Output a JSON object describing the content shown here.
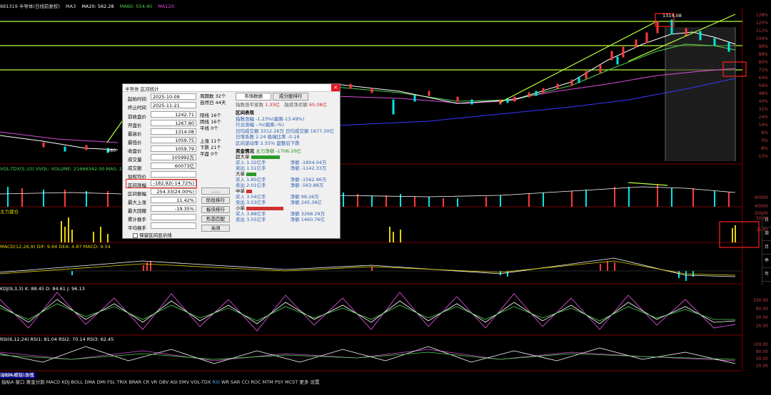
{
  "header": {
    "title": "881319 半导体(日线前复权)",
    "ma3": "MA3",
    "ma20": "MA20: 562.28",
    "ma60": "MA60: 554.40",
    "ma120": "MA120:"
  },
  "price_axis": [
    "128%",
    "120%",
    "112%",
    "104%",
    "96%",
    "88%",
    "80%",
    "72%",
    "64%",
    "56%",
    "48%",
    "40%",
    "32%",
    "24%",
    "16%",
    "8%",
    "0%",
    "-8%",
    "-15%"
  ],
  "chart_labels": {
    "high": "1314.08",
    "low_left": "480"
  },
  "vol": {
    "label": "VOL-TDX(5,10) VVOL: VOLUME: 21666342.00  MA5: 2",
    "axis": [
      "60000",
      "40000",
      "20000"
    ]
  },
  "main_force": {
    "label": "主力建仓",
    "axis": [
      "30.00",
      "15.00"
    ]
  },
  "macd": {
    "label": "MACD(12,26,9) DIF: 9.64  DEA: 4.87  MACD: 9.54"
  },
  "kdj": {
    "label": "KDJ(9,3,3) K: 88.45  D: 84.61  J: 96.13",
    "axis": [
      "100.00",
      "80.00",
      "50.00",
      "20.00"
    ]
  },
  "rsi": {
    "label": "RSI(6,12,24) RSI1: 81.04  RSI2: 70.14  RSI3: 62.45",
    "axis": [
      "100.00",
      "80.00",
      "50.00",
      "20.00"
    ]
  },
  "right_sidebar": [
    "日",
    "周",
    "月",
    "季",
    "年"
  ],
  "date_marker": "2024/07/19/五",
  "indicator_tabs": [
    "指标A",
    "窗口",
    "黄金分割",
    "MACD",
    "KDJ",
    "BOLL",
    "DMA",
    "DMI",
    "FSL",
    "TRIX",
    "BRAR",
    "CR",
    "VR",
    "OBV",
    "ASI",
    "EMV",
    "VOL-TDX",
    "RSI",
    "WR",
    "SAR",
    "CCI",
    "ROC",
    "MTM",
    "PSY",
    "MCST",
    "更多",
    "设置"
  ],
  "bottom_right": [
    "指标B",
    "模板",
    "日线"
  ],
  "dialog": {
    "title": "半导体 区间统计",
    "start_label": "起始时间",
    "start_value": "2025-10-09",
    "end_label": "终止时间",
    "end_value": "2025-11-21",
    "stats": [
      {
        "label": "前收盘价",
        "value": "1242.71"
      },
      {
        "label": "开盘价",
        "value": "1267.80"
      },
      {
        "label": "最高价",
        "value": "1314.08"
      },
      {
        "label": "最低价",
        "value": "1059.75"
      },
      {
        "label": "收盘价",
        "value": "1059.79"
      },
      {
        "label": "成交量",
        "value": "105992万"
      },
      {
        "label": "成交额",
        "value": "60073亿"
      },
      {
        "label": "加权均价",
        "value": ""
      },
      {
        "label": "区间涨幅",
        "value": "-182.92(-14.72%)"
      },
      {
        "label": "区间振幅",
        "value": "254.33(24.00%)"
      },
      {
        "label": "最大上涨",
        "value": "11.42%"
      },
      {
        "label": "最大回撤",
        "value": "-19.35%"
      },
      {
        "label": "累计换手",
        "value": ""
      },
      {
        "label": "平均换手",
        "value": ""
      }
    ],
    "period": "周期数 32个",
    "natural_days": "自然日 44天",
    "yang": "阳线 16个",
    "yin": "阴线 16个",
    "flat": "平线 0个",
    "up": "上涨 11个",
    "down": "下跌 21个",
    "flat2": "平盘 0个",
    "btn_dots": "......",
    "btn_rank": "阶段排行",
    "btn_sector": "板块排行",
    "btn_pattern": "形态匹配",
    "btn_close": "关闭",
    "keep_label": "保留区间显示线",
    "tab_market": "市场数据",
    "tab_rank": "成分股排行",
    "inflow_label": "指数涨平家数",
    "inflow_value": "1.33亿",
    "inflow2_label": "融资净买额",
    "inflow2_value": "65.08亿",
    "section_perf": "区间表现",
    "perf_rows": [
      "指数涨幅 -1.23%(偏离-13.49%)",
      "行业涨幅 --%(偏离--%)",
      "日均成交额 3312.26万    日均成交额 1877.30亿",
      "日增系数 2.24          极端比率 -0.18",
      "区间波动率 2.55%      盘整后下跌"
    ],
    "funds_title": "资金情况",
    "funds_net": "主力净额 -1706.20亿",
    "groups": [
      {
        "name": "超大单",
        "color": "#2a9a2a",
        "buy": "买入 1.32亿手",
        "sell": "卖出 1.51亿手",
        "net": "净额 -1804.04万"
      },
      {
        "name": "大单",
        "color": "#2a9a2a",
        "buy": "买入 1.85亿手",
        "sell": "卖出 2.01亿手",
        "net": "净额 -1562.96万"
      },
      {
        "name": "中单",
        "color": "#d03030",
        "buy": "买入 3.54亿手",
        "sell": "卖出 3.53亿手",
        "net": "净额 98.26万"
      },
      {
        "name": "小单",
        "color": "#d03030",
        "buy": "买入 3.88亿手",
        "sell": "卖出 3.55亿手",
        "net": "净额 3268.29万"
      }
    ],
    "extra_net": [
      "净额 -1142.33万",
      "净额 -563.88万",
      "净额 245.39亿",
      "净额 1460.76亿"
    ]
  }
}
